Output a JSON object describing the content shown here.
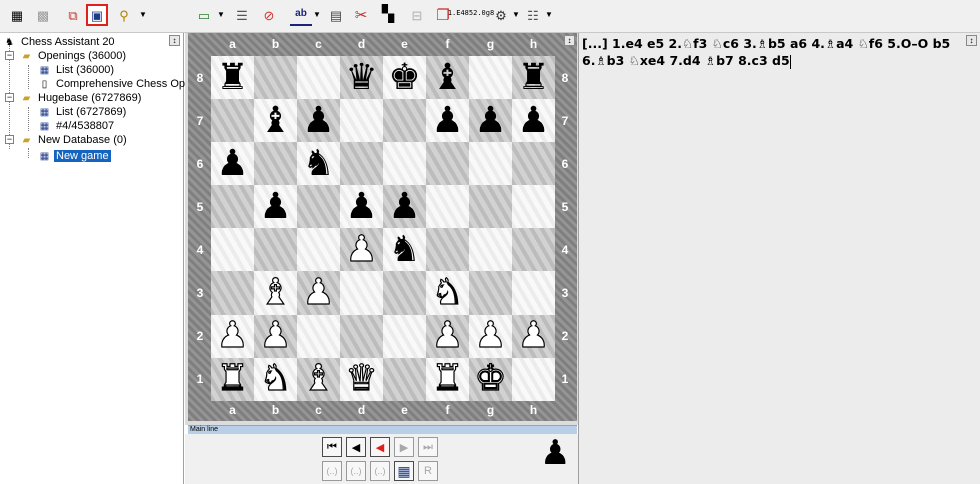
{
  "toolbar": {
    "buttons": [
      {
        "icon": "grid-icon",
        "glyph": "▦"
      },
      {
        "icon": "grid-dim-icon",
        "glyph": "▩"
      },
      {
        "icon": "database-copy-icon",
        "glyph": "⧉"
      },
      {
        "icon": "save-database-icon",
        "glyph": "▣"
      },
      {
        "icon": "search-icon",
        "glyph": "⚲"
      },
      {
        "icon": "monitor-icon",
        "glyph": "▭"
      },
      {
        "icon": "list-filter-icon",
        "glyph": "☰"
      },
      {
        "icon": "stop-icon",
        "glyph": "⊘"
      },
      {
        "icon": "text-box-icon",
        "glyph": "ab"
      },
      {
        "icon": "calculator-icon",
        "glyph": "▤"
      },
      {
        "icon": "cut-icon",
        "glyph": "✂"
      },
      {
        "icon": "checkerboard-icon",
        "glyph": "▚"
      },
      {
        "icon": "split-icon",
        "glyph": "⊟"
      },
      {
        "icon": "copy-icon",
        "glyph": "❐"
      },
      {
        "icon": "engine-icon",
        "glyph": "⚙"
      },
      {
        "icon": "list-options-icon",
        "glyph": "☷"
      }
    ],
    "eval_lines": [
      "1.E485",
      "2.0",
      "g8"
    ]
  },
  "tree": {
    "root": "Chess Assistant 20",
    "items": [
      {
        "label": "Openings (36000)"
      },
      {
        "label": "List (36000)"
      },
      {
        "label": "Comprehensive Chess Openin"
      },
      {
        "label": "Hugebase (6727869)"
      },
      {
        "label": "List (6727869)"
      },
      {
        "label": "#4/4538807"
      },
      {
        "label": "New Database (0)"
      },
      {
        "label": "New game"
      }
    ]
  },
  "board": {
    "files": [
      "a",
      "b",
      "c",
      "d",
      "e",
      "f",
      "g",
      "h"
    ],
    "ranks": [
      "8",
      "7",
      "6",
      "5",
      "4",
      "3",
      "2",
      "1"
    ],
    "rows": [
      [
        "br",
        "",
        "",
        "bq",
        "bk",
        "bb",
        "",
        "br"
      ],
      [
        "",
        "bb",
        "bp",
        "",
        "",
        "bp",
        "bp",
        "bp"
      ],
      [
        "bp",
        "",
        "bn",
        "",
        "",
        "",
        "",
        ""
      ],
      [
        "",
        "bp",
        "",
        "bp",
        "bp",
        "",
        "",
        ""
      ],
      [
        "",
        "",
        "",
        "wp",
        "bn",
        "",
        "",
        ""
      ],
      [
        "",
        "wb",
        "wp",
        "",
        "",
        "wn",
        "",
        ""
      ],
      [
        "wp",
        "wp",
        "",
        "",
        "",
        "wp",
        "wp",
        "wp"
      ],
      [
        "wr",
        "wn",
        "wb",
        "wq",
        "",
        "wr",
        "wk",
        ""
      ]
    ]
  },
  "mainline": {
    "label": "Main line"
  },
  "nav": {
    "buttons": [
      {
        "name": "first-move-button",
        "glyph": "⏮",
        "state": "active"
      },
      {
        "name": "prev-move-button",
        "glyph": "◀",
        "state": "active"
      },
      {
        "name": "prev-red-button",
        "glyph": "◀",
        "state": "active"
      },
      {
        "name": "next-move-button",
        "glyph": "▶",
        "state": "disabled"
      },
      {
        "name": "last-move-button",
        "glyph": "⏭",
        "state": "disabled"
      },
      {
        "name": "variation-1-button",
        "glyph": "(..)",
        "state": "disabled"
      },
      {
        "name": "variation-2-button",
        "glyph": "(..)",
        "state": "disabled"
      },
      {
        "name": "variation-3-button",
        "glyph": "(..)",
        "state": "disabled"
      },
      {
        "name": "table-button",
        "glyph": "▦",
        "state": "active"
      },
      {
        "name": "r-button",
        "glyph": "R",
        "state": "disabled"
      }
    ],
    "side_to_move": "♟"
  },
  "notation": {
    "text": "[...] 1.e4 e5 2.♘f3 ♘c6 3.♗b5 a6 4.♗a4 ♘f6 5.O–O b5 6.♗b3 ♘xe4 7.d4 ♗b7 8.c3 d5"
  },
  "colors": {
    "accent": "#1565c0",
    "red": "#e0201c",
    "toolbar_bg": "#f0f0f0",
    "notation_bg": "#ececec",
    "mainline_bar": "#b9cfe8"
  }
}
